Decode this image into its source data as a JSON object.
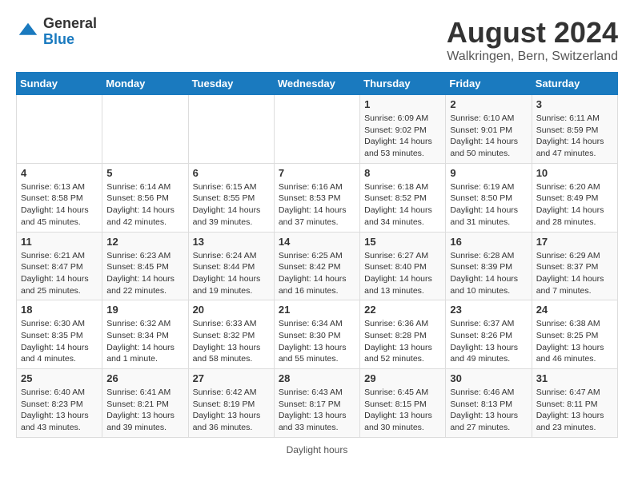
{
  "header": {
    "logo": {
      "general": "General",
      "blue": "Blue"
    },
    "title": "August 2024",
    "subtitle": "Walkringen, Bern, Switzerland"
  },
  "calendar": {
    "days_of_week": [
      "Sunday",
      "Monday",
      "Tuesday",
      "Wednesday",
      "Thursday",
      "Friday",
      "Saturday"
    ],
    "weeks": [
      [
        {
          "day": "",
          "info": ""
        },
        {
          "day": "",
          "info": ""
        },
        {
          "day": "",
          "info": ""
        },
        {
          "day": "",
          "info": ""
        },
        {
          "day": "1",
          "info": "Sunrise: 6:09 AM\nSunset: 9:02 PM\nDaylight: 14 hours\nand 53 minutes."
        },
        {
          "day": "2",
          "info": "Sunrise: 6:10 AM\nSunset: 9:01 PM\nDaylight: 14 hours\nand 50 minutes."
        },
        {
          "day": "3",
          "info": "Sunrise: 6:11 AM\nSunset: 8:59 PM\nDaylight: 14 hours\nand 47 minutes."
        }
      ],
      [
        {
          "day": "4",
          "info": "Sunrise: 6:13 AM\nSunset: 8:58 PM\nDaylight: 14 hours\nand 45 minutes."
        },
        {
          "day": "5",
          "info": "Sunrise: 6:14 AM\nSunset: 8:56 PM\nDaylight: 14 hours\nand 42 minutes."
        },
        {
          "day": "6",
          "info": "Sunrise: 6:15 AM\nSunset: 8:55 PM\nDaylight: 14 hours\nand 39 minutes."
        },
        {
          "day": "7",
          "info": "Sunrise: 6:16 AM\nSunset: 8:53 PM\nDaylight: 14 hours\nand 37 minutes."
        },
        {
          "day": "8",
          "info": "Sunrise: 6:18 AM\nSunset: 8:52 PM\nDaylight: 14 hours\nand 34 minutes."
        },
        {
          "day": "9",
          "info": "Sunrise: 6:19 AM\nSunset: 8:50 PM\nDaylight: 14 hours\nand 31 minutes."
        },
        {
          "day": "10",
          "info": "Sunrise: 6:20 AM\nSunset: 8:49 PM\nDaylight: 14 hours\nand 28 minutes."
        }
      ],
      [
        {
          "day": "11",
          "info": "Sunrise: 6:21 AM\nSunset: 8:47 PM\nDaylight: 14 hours\nand 25 minutes."
        },
        {
          "day": "12",
          "info": "Sunrise: 6:23 AM\nSunset: 8:45 PM\nDaylight: 14 hours\nand 22 minutes."
        },
        {
          "day": "13",
          "info": "Sunrise: 6:24 AM\nSunset: 8:44 PM\nDaylight: 14 hours\nand 19 minutes."
        },
        {
          "day": "14",
          "info": "Sunrise: 6:25 AM\nSunset: 8:42 PM\nDaylight: 14 hours\nand 16 minutes."
        },
        {
          "day": "15",
          "info": "Sunrise: 6:27 AM\nSunset: 8:40 PM\nDaylight: 14 hours\nand 13 minutes."
        },
        {
          "day": "16",
          "info": "Sunrise: 6:28 AM\nSunset: 8:39 PM\nDaylight: 14 hours\nand 10 minutes."
        },
        {
          "day": "17",
          "info": "Sunrise: 6:29 AM\nSunset: 8:37 PM\nDaylight: 14 hours\nand 7 minutes."
        }
      ],
      [
        {
          "day": "18",
          "info": "Sunrise: 6:30 AM\nSunset: 8:35 PM\nDaylight: 14 hours\nand 4 minutes."
        },
        {
          "day": "19",
          "info": "Sunrise: 6:32 AM\nSunset: 8:34 PM\nDaylight: 14 hours\nand 1 minute."
        },
        {
          "day": "20",
          "info": "Sunrise: 6:33 AM\nSunset: 8:32 PM\nDaylight: 13 hours\nand 58 minutes."
        },
        {
          "day": "21",
          "info": "Sunrise: 6:34 AM\nSunset: 8:30 PM\nDaylight: 13 hours\nand 55 minutes."
        },
        {
          "day": "22",
          "info": "Sunrise: 6:36 AM\nSunset: 8:28 PM\nDaylight: 13 hours\nand 52 minutes."
        },
        {
          "day": "23",
          "info": "Sunrise: 6:37 AM\nSunset: 8:26 PM\nDaylight: 13 hours\nand 49 minutes."
        },
        {
          "day": "24",
          "info": "Sunrise: 6:38 AM\nSunset: 8:25 PM\nDaylight: 13 hours\nand 46 minutes."
        }
      ],
      [
        {
          "day": "25",
          "info": "Sunrise: 6:40 AM\nSunset: 8:23 PM\nDaylight: 13 hours\nand 43 minutes."
        },
        {
          "day": "26",
          "info": "Sunrise: 6:41 AM\nSunset: 8:21 PM\nDaylight: 13 hours\nand 39 minutes."
        },
        {
          "day": "27",
          "info": "Sunrise: 6:42 AM\nSunset: 8:19 PM\nDaylight: 13 hours\nand 36 minutes."
        },
        {
          "day": "28",
          "info": "Sunrise: 6:43 AM\nSunset: 8:17 PM\nDaylight: 13 hours\nand 33 minutes."
        },
        {
          "day": "29",
          "info": "Sunrise: 6:45 AM\nSunset: 8:15 PM\nDaylight: 13 hours\nand 30 minutes."
        },
        {
          "day": "30",
          "info": "Sunrise: 6:46 AM\nSunset: 8:13 PM\nDaylight: 13 hours\nand 27 minutes."
        },
        {
          "day": "31",
          "info": "Sunrise: 6:47 AM\nSunset: 8:11 PM\nDaylight: 13 hours\nand 23 minutes."
        }
      ]
    ]
  },
  "footer": {
    "note": "Daylight hours"
  }
}
